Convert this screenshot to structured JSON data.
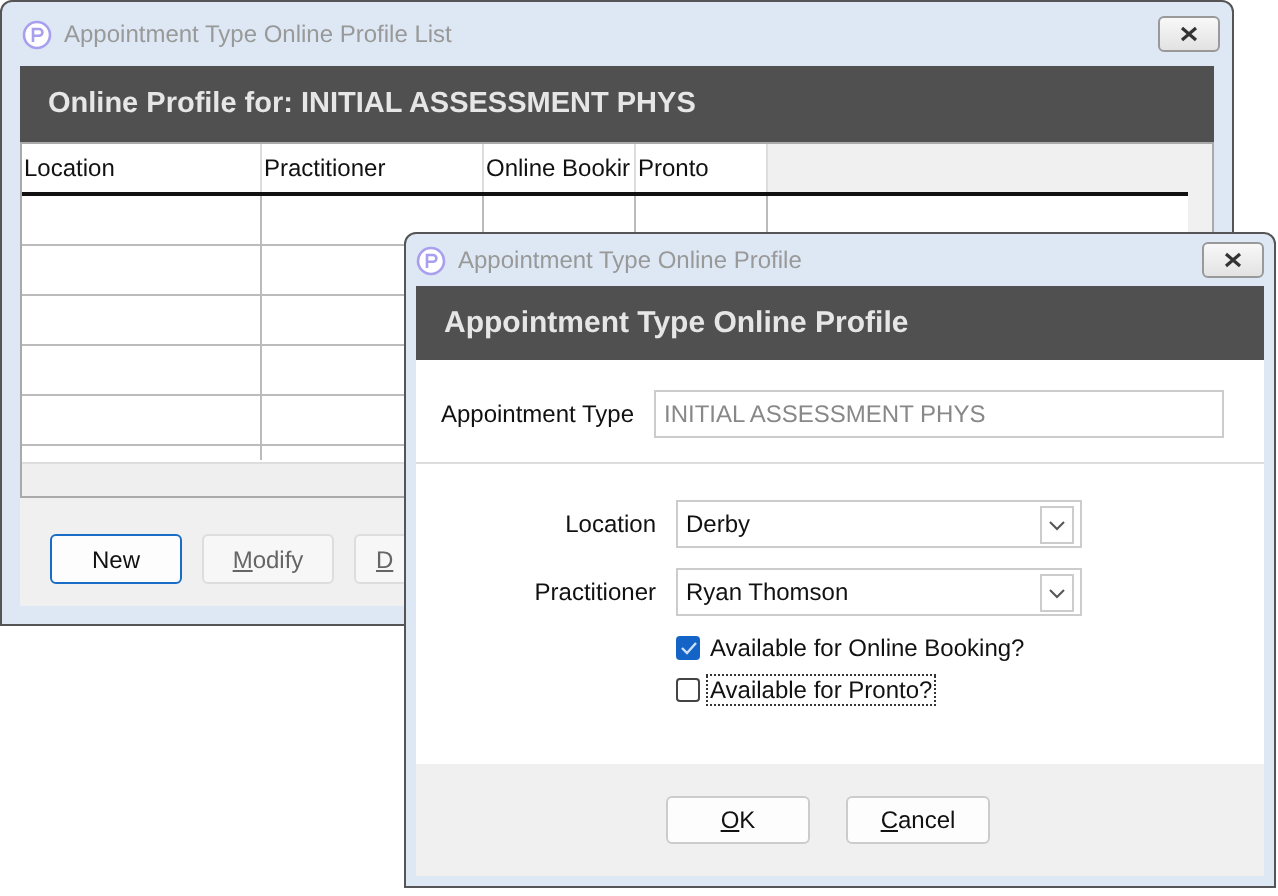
{
  "list_window": {
    "title": "Appointment Type Online Profile List",
    "header": "Online Profile for: INITIAL ASSESSMENT PHYS",
    "table": {
      "columns": [
        "Location",
        "Practitioner",
        "Online Bookir",
        "Pronto"
      ]
    },
    "buttons": [
      {
        "label": "New",
        "default": true
      },
      {
        "accel": "M",
        "label": "odify",
        "default": false
      },
      {
        "accel": "D",
        "default": false
      }
    ]
  },
  "dialog": {
    "title": "Appointment Type Online Profile",
    "header": "Appointment Type Online Profile",
    "appointment_type": {
      "label": "Appointment Type",
      "value": "INITIAL ASSESSMENT PHYS",
      "disabled": true
    },
    "location": {
      "label": "Location",
      "value": "Derby"
    },
    "practitioner": {
      "label": "Practitioner",
      "value": "Ryan Thomson"
    },
    "checkboxes": [
      {
        "label": "Available for Online Booking?",
        "checked": true,
        "focused": false
      },
      {
        "label": "Available for Pronto?",
        "checked": false,
        "focused": true
      }
    ],
    "buttons": [
      {
        "accel": "O",
        "label": "K"
      },
      {
        "accel": "C",
        "label": "ancel"
      }
    ]
  }
}
